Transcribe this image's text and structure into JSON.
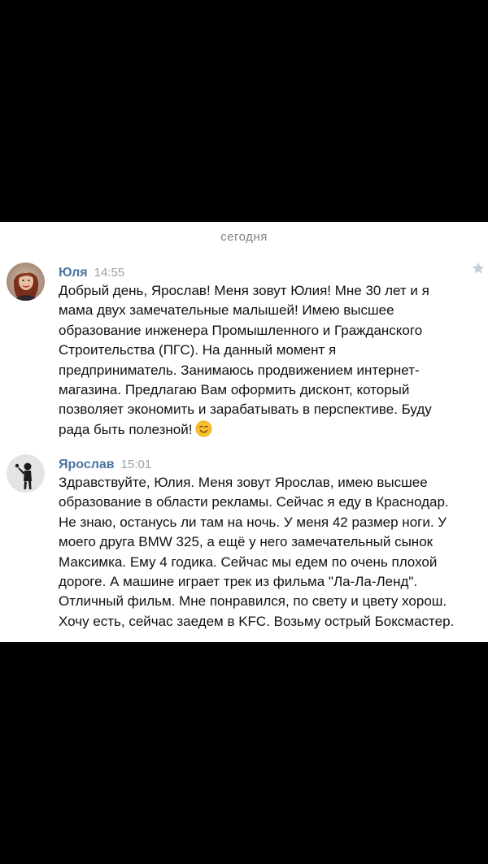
{
  "chat": {
    "date_separator": "сегодня",
    "messages": [
      {
        "author": "Юля",
        "time": "14:55",
        "text": "Добрый день, Ярослав! Меня зовут Юлия! Мне 30 лет и я\nмама двух замечательные малышей! Имею высшее\nобразование инженера Промышленного и Гражданского\nСтроительства (ПГС). На данный момент я\nпредприниматель. Занимаюсь продвижением интернет-\nмагазина. Предлагаю Вам оформить дисконт, который\nпозволяет экономить и зарабатывать в перспективе. Буду\nрада быть полезной!",
        "emoji": "smiling-face-emoji",
        "avatar": "user-photo-woman",
        "star_icon": "star-icon"
      },
      {
        "author": "Ярослав",
        "time": "15:01",
        "text": "Здравствуйте, Юлия. Меня зовут Ярослав, имею высшее\nобразование в области рекламы. Сейчас я еду в Краснодар.\nНе знаю, останусь ли там на ночь. У меня 42 размер ноги. У\nмоего друга BMW 325, а ещё у него замечательный сынок\nМаксимка. Ему 4 годика. Сейчас мы едем по очень плохой\nдороге. А машине играет трек из фильма \"Ла-Ла-Ленд\".\nОтличный фильм. Мне понравился, по свету и цвету хорош.\nХочу есть, сейчас заедем в KFC. Возьму острый Боксмастер.",
        "avatar": "user-photo-man"
      }
    ]
  },
  "colors": {
    "author_name": "#4c75a3",
    "timestamp": "#9ba1a8",
    "message_text": "#111111",
    "date_separator": "#7f8285",
    "star": "#c5d0dc",
    "background_frame": "#000000",
    "chat_background": "#ffffff"
  }
}
